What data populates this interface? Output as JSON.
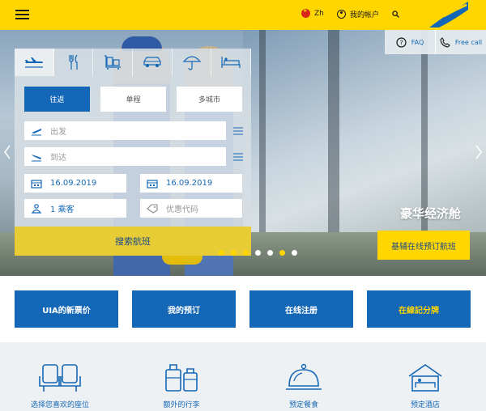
{
  "header": {
    "lang_label": "Zh",
    "account_label": "我的帐户"
  },
  "info_bar": {
    "faq_label": "FAQ",
    "call_label": "Free call"
  },
  "widget": {
    "trip_types": [
      "往返",
      "单程",
      "多城市"
    ],
    "from_placeholder": "出发",
    "to_placeholder": "到达",
    "depart_date": "16.09.2019",
    "return_date": "16.09.2019",
    "passengers": "1 乘客",
    "promo_placeholder": "优惠代码",
    "search_label": "搜索航班"
  },
  "promo": {
    "title": "豪华经济舱",
    "button_label": "基辅在线预订航班"
  },
  "tiles": [
    "UIA的新票价",
    "我的预订",
    "在线注册",
    "在線記分牌"
  ],
  "services": [
    "选择您喜欢的座位",
    "额外的行李",
    "预定餐食",
    "预定酒店"
  ],
  "colors": {
    "brand_yellow": "#ffd600",
    "brand_blue": "#1467b6"
  }
}
